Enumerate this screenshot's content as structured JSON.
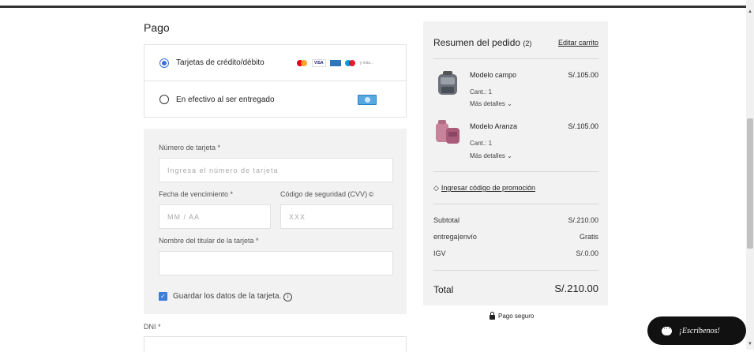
{
  "payment": {
    "title": "Pago",
    "options": [
      {
        "label": "Tarjetas de crédito/débito",
        "more": "y más..."
      },
      {
        "label": "En efectivo al ser entregado"
      }
    ],
    "card_logos": [
      "mastercard",
      "visa",
      "amex",
      "maestro"
    ]
  },
  "card_form": {
    "number_label": "Número de tarjeta *",
    "number_placeholder": "Ingresa el número de tarjeta",
    "expiry_label": "Fecha de vencimiento *",
    "expiry_placeholder": "MM / AA",
    "cvv_label": "Código de seguridad (CVV)",
    "cvv_placeholder": "XXX",
    "holder_label": "Nombre del titular de la tarjeta *",
    "holder_value": "",
    "save_label": "Guardar los datos de la tarjeta.",
    "save_checked": true
  },
  "dni": {
    "label": "DNI *",
    "value": ""
  },
  "summary": {
    "title": "Resumen del pedido",
    "count": "(2)",
    "edit_cart": "Editar carrito",
    "items": [
      {
        "name": "Modelo campo",
        "price": "S/.105.00",
        "qty": "Cant.: 1",
        "more": "Más detalles"
      },
      {
        "name": "Modelo Aranza",
        "price": "S/.105.00",
        "qty": "Cant.: 1",
        "more": "Más detalles"
      }
    ],
    "promo": "Ingresar código de promoción",
    "subtotal_label": "Subtotal",
    "subtotal_value": "S/.210.00",
    "shipping_label": "entrega|envío",
    "shipping_value": "Gratis",
    "tax_label": "IGV",
    "tax_value": "S/.0.00",
    "total_label": "Total",
    "total_value": "S/.210.00"
  },
  "secure_label": "Pago seguro",
  "chat_label": "¡Escríbenos!",
  "colors": {
    "accent": "#3b6fd8",
    "panel": "#f2f2f2",
    "chat": "#111111"
  }
}
